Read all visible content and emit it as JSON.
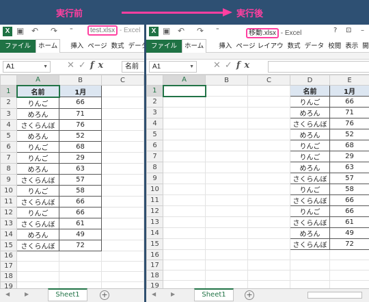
{
  "banner": {
    "before": "実行前",
    "after": "実行後"
  },
  "left": {
    "title_file": "test.xlsx",
    "title_suffix": " - Excel",
    "tabs": [
      "ファイル",
      "ホーム",
      "",
      "挿入",
      "ページ",
      "数式",
      "データ",
      "校"
    ],
    "namebox": "A1",
    "formula": "名前",
    "columns": [
      "A",
      "B",
      "C"
    ],
    "header": [
      "名前",
      "1月"
    ],
    "rows": [
      [
        "りんご",
        "66"
      ],
      [
        "めろん",
        "71"
      ],
      [
        "さくらんぼ",
        "76"
      ],
      [
        "めろん",
        "52"
      ],
      [
        "りんご",
        "68"
      ],
      [
        "りんご",
        "29"
      ],
      [
        "めろん",
        "63"
      ],
      [
        "さくらんぼ",
        "57"
      ],
      [
        "りんご",
        "58"
      ],
      [
        "さくらんぼ",
        "66"
      ],
      [
        "りんご",
        "66"
      ],
      [
        "さくらんぼ",
        "61"
      ],
      [
        "めろん",
        "49"
      ],
      [
        "さくらんぼ",
        "72"
      ]
    ],
    "row_numbers": [
      "1",
      "2",
      "3",
      "4",
      "5",
      "6",
      "7",
      "8",
      "9",
      "10",
      "11",
      "12",
      "13",
      "14",
      "15",
      "16",
      "17",
      "18",
      "19"
    ],
    "sheet_tab": "Sheet1"
  },
  "right": {
    "title_file": "移動.xlsx",
    "title_suffix": " - Excel",
    "title_buttons": [
      "?",
      "⊡",
      "–"
    ],
    "tabs": [
      "ファイル",
      "ホーム",
      "",
      "挿入",
      "ページ レイアウ",
      "数式",
      "データ",
      "校閲",
      "表示",
      "開発",
      "帳"
    ],
    "namebox": "A1",
    "formula": "",
    "columns": [
      "A",
      "B",
      "C",
      "D",
      "E"
    ],
    "header": [
      "名前",
      "1月"
    ],
    "rows": [
      [
        "りんご",
        "66"
      ],
      [
        "めろん",
        "71"
      ],
      [
        "さくらんぼ",
        "76"
      ],
      [
        "めろん",
        "52"
      ],
      [
        "りんご",
        "68"
      ],
      [
        "りんご",
        "29"
      ],
      [
        "めろん",
        "63"
      ],
      [
        "さくらんぼ",
        "57"
      ],
      [
        "りんご",
        "58"
      ],
      [
        "さくらんぼ",
        "66"
      ],
      [
        "りんご",
        "66"
      ],
      [
        "さくらんぼ",
        "61"
      ],
      [
        "めろん",
        "49"
      ],
      [
        "さくらんぼ",
        "72"
      ]
    ],
    "row_numbers": [
      "1",
      "2",
      "3",
      "4",
      "5",
      "6",
      "7",
      "8",
      "9",
      "10",
      "11",
      "12",
      "13",
      "14",
      "15",
      "16",
      "17",
      "18",
      "19"
    ],
    "sheet_tab": "Sheet1"
  },
  "colors": {
    "accent": "#ff3fa0",
    "excel_green": "#1f7244",
    "header_fill": "#dce6f1"
  }
}
